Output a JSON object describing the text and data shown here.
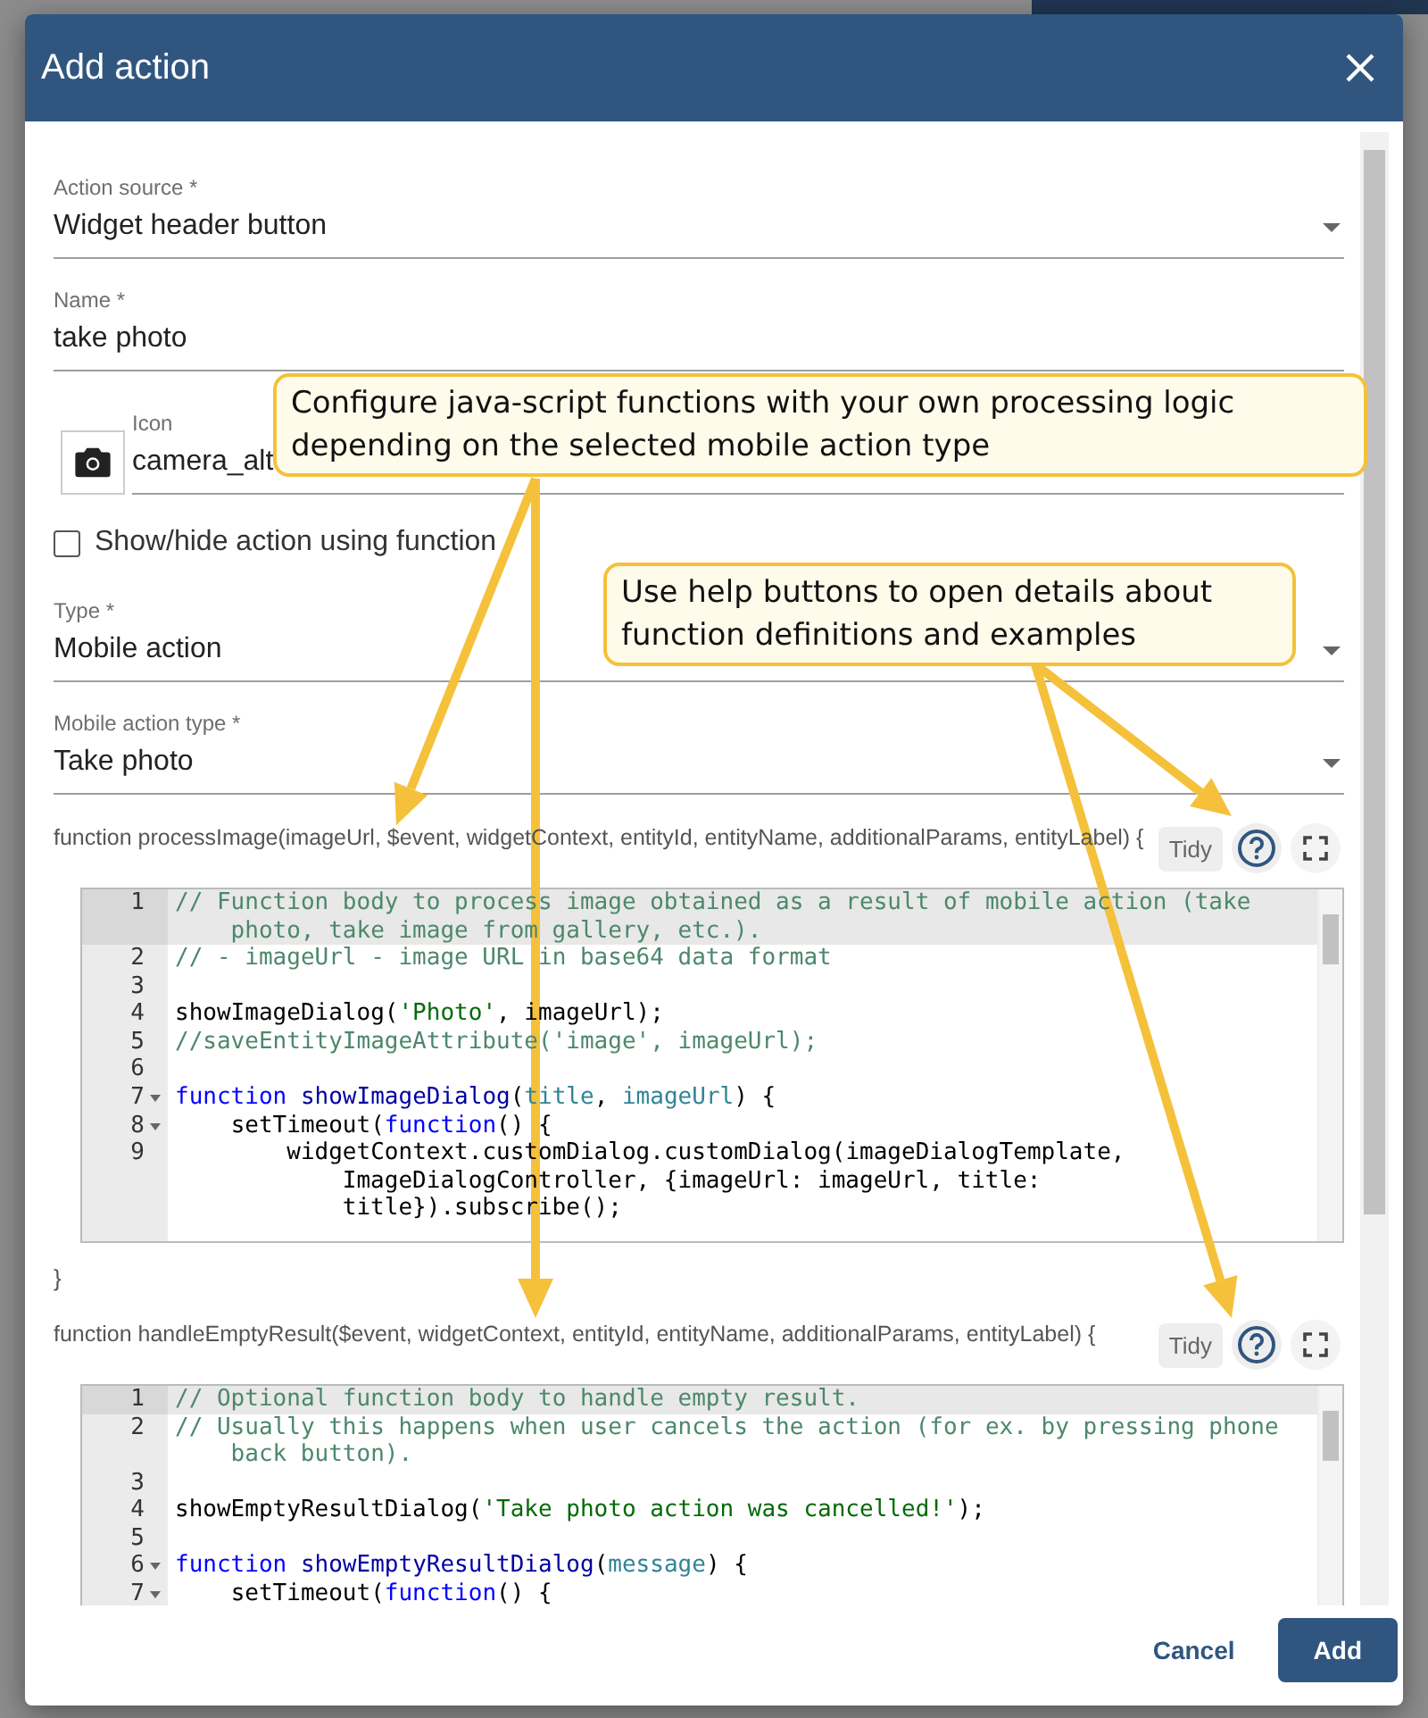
{
  "dialog": {
    "title": "Add action"
  },
  "fields": [
    {
      "kind": "select",
      "label": "Action source *",
      "value": "Widget header button"
    },
    {
      "kind": "text",
      "label": "Name *",
      "value": "take photo"
    },
    {
      "kind": "icon",
      "label": "Icon",
      "value": "camera_alt"
    },
    {
      "kind": "checkbox",
      "label": "Show/hide action using function",
      "checked": false
    },
    {
      "kind": "select",
      "label": "Type *",
      "value": "Mobile action"
    },
    {
      "kind": "select",
      "label": "Mobile action type *",
      "value": "Take photo"
    }
  ],
  "functions": [
    {
      "signature": "function processImage(imageUrl, $event, widgetContext, entityId, entityName, additionalParams, entityLabel) {",
      "tidy": "Tidy",
      "closing": "}",
      "lines": [
        {
          "number": "1",
          "active": true,
          "foldable": false,
          "tokens": [
            {
              "kind": "comment",
              "text": "// Function body to process image obtained as a result of mobile action (take photo, take image from gallery, etc.)."
            }
          ]
        },
        {
          "number": "2",
          "active": false,
          "foldable": false,
          "tokens": [
            {
              "kind": "comment",
              "text": "// - imageUrl - image URL in base64 data format"
            }
          ]
        },
        {
          "number": "3",
          "active": false,
          "foldable": false
        },
        {
          "number": "4",
          "active": false,
          "foldable": false,
          "tokens": [
            {
              "kind": "plain",
              "text": "showImageDialog("
            },
            {
              "kind": "string",
              "text": "'Photo'"
            },
            {
              "kind": "plain",
              "text": ", imageUrl);"
            }
          ]
        },
        {
          "number": "5",
          "active": false,
          "foldable": false,
          "tokens": [
            {
              "kind": "comment",
              "text": "//saveEntityImageAttribute('image', imageUrl);"
            }
          ]
        },
        {
          "number": "6",
          "active": false,
          "foldable": false
        },
        {
          "number": "7",
          "active": false,
          "foldable": true,
          "tokens": [
            {
              "kind": "keyword",
              "text": "function"
            },
            {
              "kind": "name",
              "text": " showImageDialog"
            },
            {
              "kind": "plain",
              "text": "("
            },
            {
              "kind": "param",
              "text": "title"
            },
            {
              "kind": "plain",
              "text": ", "
            },
            {
              "kind": "param",
              "text": "imageUrl"
            },
            {
              "kind": "plain",
              "text": ") {"
            }
          ]
        },
        {
          "number": "8",
          "active": false,
          "foldable": true,
          "tokens": [
            {
              "kind": "plain",
              "text": "    setTimeout("
            },
            {
              "kind": "keyword",
              "text": "function"
            },
            {
              "kind": "plain",
              "text": "() {"
            }
          ]
        },
        {
          "number": "9",
          "active": false,
          "foldable": false,
          "tokens": [
            {
              "kind": "plain",
              "text": "        widgetContext.customDialog.customDialog(imageDialogTemplate, ImageDialogController, {imageUrl: imageUrl, title: title}).subscribe();"
            }
          ]
        }
      ]
    },
    {
      "signature": "function handleEmptyResult($event, widgetContext, entityId, entityName, additionalParams, entityLabel) {",
      "tidy": "Tidy",
      "lines": [
        {
          "number": "1",
          "active": true,
          "foldable": false,
          "tokens": [
            {
              "kind": "comment",
              "text": "// Optional function body to handle empty result."
            }
          ]
        },
        {
          "number": "2",
          "active": false,
          "foldable": false,
          "tokens": [
            {
              "kind": "comment",
              "text": "// Usually this happens when user cancels the action (for ex. by pressing phone back button)."
            }
          ]
        },
        {
          "number": "3",
          "active": false,
          "foldable": false
        },
        {
          "number": "4",
          "active": false,
          "foldable": false,
          "tokens": [
            {
              "kind": "plain",
              "text": "showEmptyResultDialog("
            },
            {
              "kind": "string",
              "text": "'Take photo action was cancelled!'"
            },
            {
              "kind": "plain",
              "text": ");"
            }
          ]
        },
        {
          "number": "5",
          "active": false,
          "foldable": false
        },
        {
          "number": "6",
          "active": false,
          "foldable": true,
          "tokens": [
            {
              "kind": "keyword",
              "text": "function"
            },
            {
              "kind": "name",
              "text": " showEmptyResultDialog"
            },
            {
              "kind": "plain",
              "text": "("
            },
            {
              "kind": "param",
              "text": "message"
            },
            {
              "kind": "plain",
              "text": ") {"
            }
          ]
        },
        {
          "number": "7",
          "active": false,
          "foldable": true,
          "tokens": [
            {
              "kind": "plain",
              "text": "    setTimeout("
            },
            {
              "kind": "keyword",
              "text": "function"
            },
            {
              "kind": "plain",
              "text": "() {"
            }
          ]
        }
      ]
    }
  ],
  "footer": {
    "cancel": "Cancel",
    "add": "Add"
  },
  "callouts": [
    {
      "text": "Configure java-script functions with your own processing logic depending on the selected mobile action type"
    },
    {
      "text": "Use help buttons to open details about function definitions and examples"
    }
  ]
}
